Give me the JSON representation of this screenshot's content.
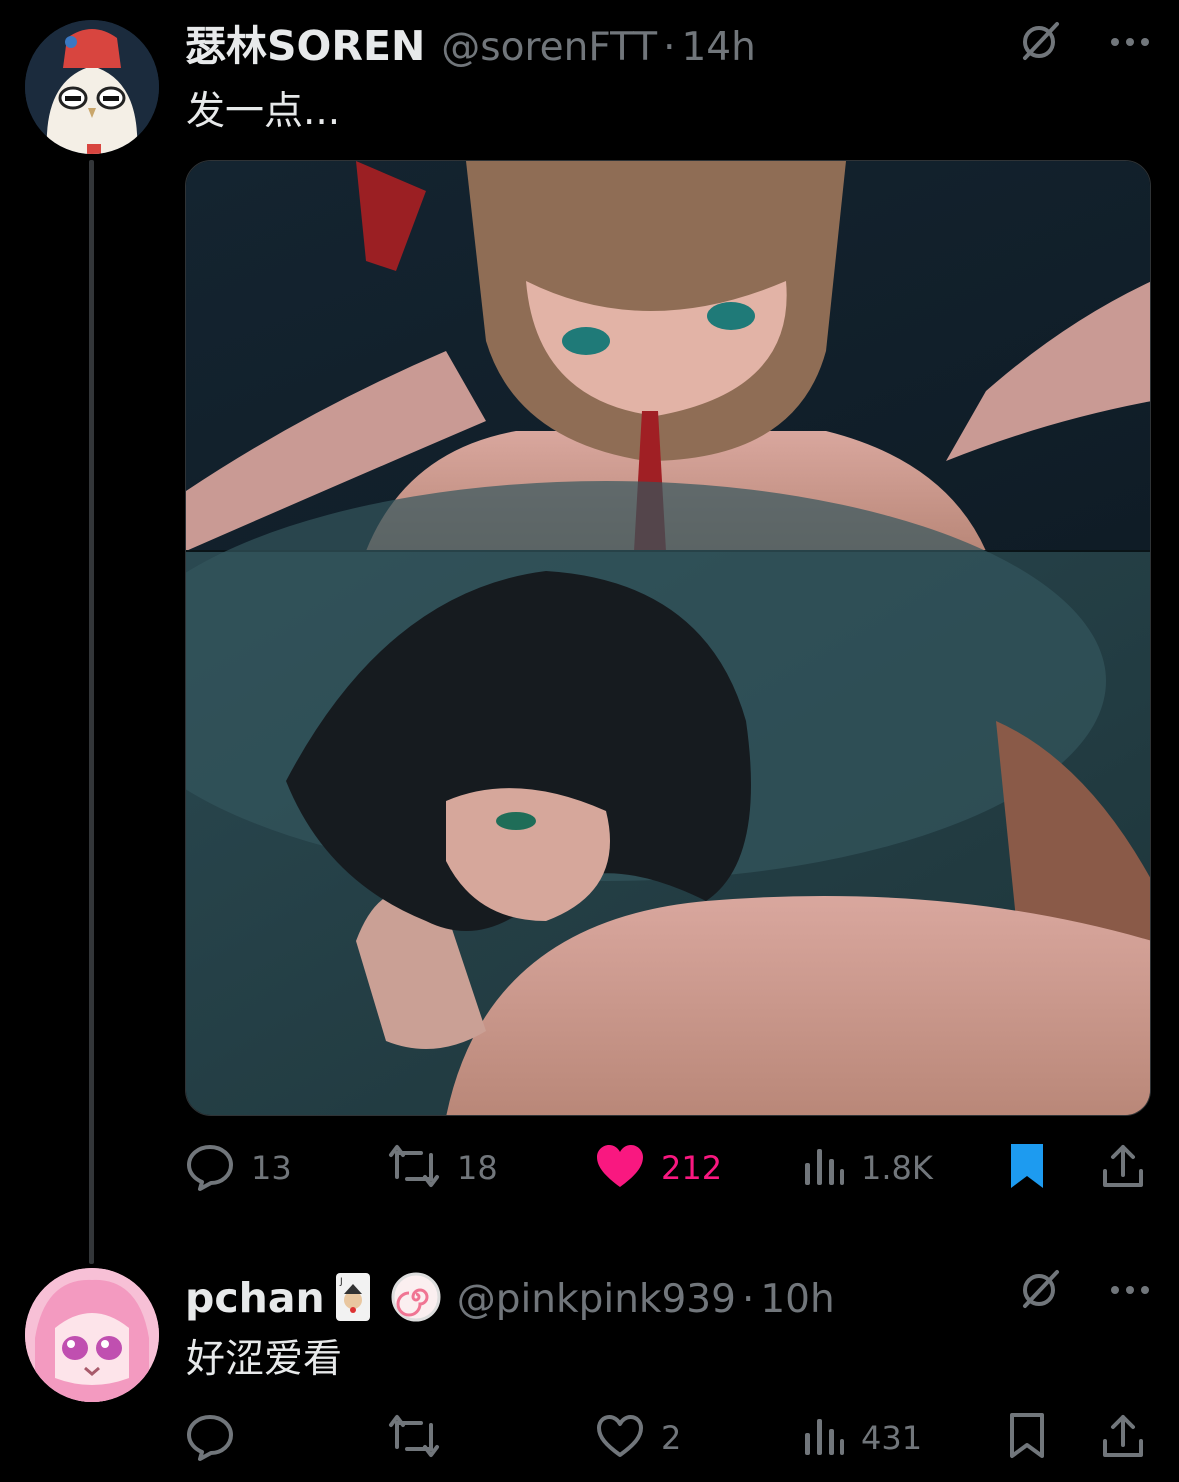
{
  "thread": {
    "posts": [
      {
        "display_name": "瑟林SOREN",
        "handle": "@sorenFTT",
        "separator": "·",
        "time": "14h",
        "text": "发一点...",
        "actions": {
          "reply_count": "13",
          "repost_count": "18",
          "like_count": "212",
          "views_count": "1.8K",
          "liked": true,
          "bookmarked": true
        }
      },
      {
        "display_name": "pchan",
        "handle": "@pinkpink939",
        "separator": "·",
        "time": "10h",
        "text": "好涩爱看",
        "actions": {
          "reply_count": "",
          "repost_count": "",
          "like_count": "2",
          "views_count": "431",
          "liked": false,
          "bookmarked": false
        }
      }
    ]
  },
  "colors": {
    "background": "#000000",
    "primary_text": "#e7e9ea",
    "secondary_text": "#71767b",
    "like_pink": "#f91880",
    "bookmark_blue": "#1d9bf0",
    "thread_line": "#333639"
  },
  "icons": [
    "grok-icon",
    "more-icon",
    "reply-icon",
    "repost-icon",
    "like-icon",
    "views-icon",
    "bookmark-icon",
    "share-icon"
  ]
}
